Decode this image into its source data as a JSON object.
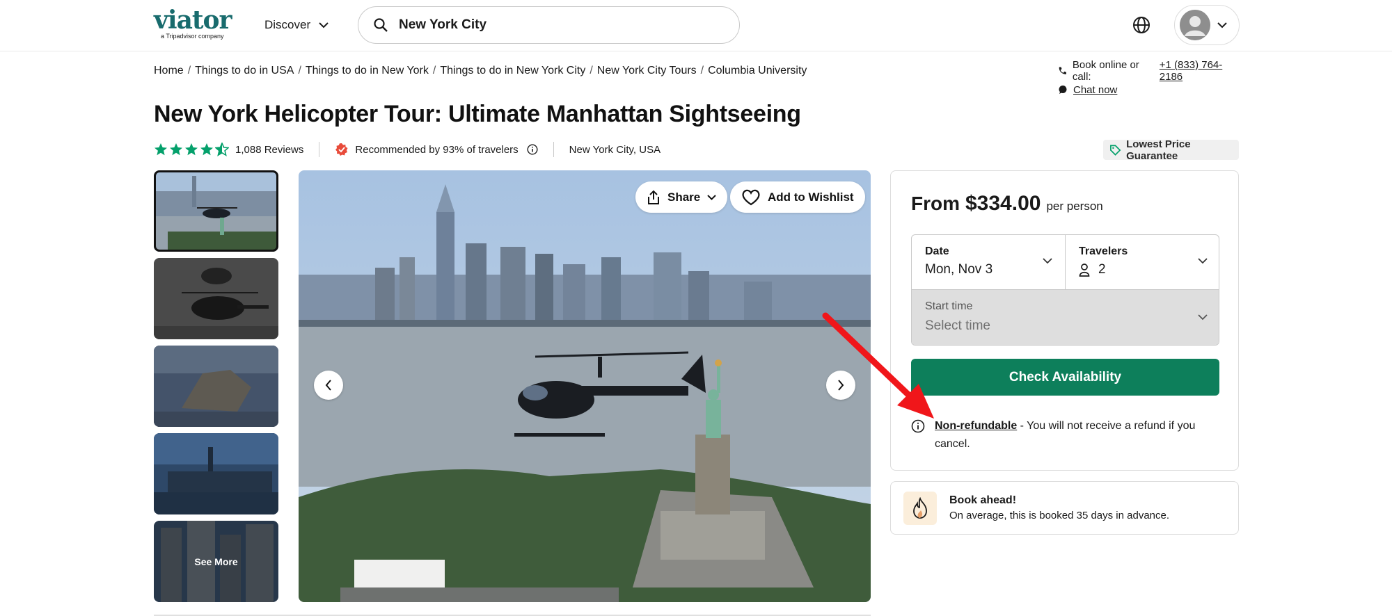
{
  "header": {
    "logo_text": "viator",
    "logo_sub": "a Tripadvisor company",
    "discover_label": "Discover",
    "search_value": "New York City",
    "brand_color": "#186b6d"
  },
  "breadcrumb": [
    "Home",
    "Things to do in USA",
    "Things to do in New York",
    "Things to do in New York City",
    "New York City Tours",
    "Columbia University"
  ],
  "contact": {
    "book_label": "Book online or call:",
    "phone": "+1 (833) 764-2186",
    "chat_label": "Chat now"
  },
  "product": {
    "title": "New York Helicopter Tour: Ultimate Manhattan Sightseeing",
    "rating": 4.5,
    "reviews_label": "1,088 Reviews",
    "recommended_label": "Recommended by 93% of travelers",
    "location": "New York City, USA",
    "lowest_price_label": "Lowest Price Guarantee",
    "star_color": "#04a06b"
  },
  "gallery": {
    "see_more_label": "See More",
    "share_label": "Share",
    "wishlist_label": "Add to Wishlist"
  },
  "booking": {
    "from_label": "From",
    "price": "$334.00",
    "per_person": "per person",
    "date_label": "Date",
    "date_value": "Mon, Nov 3",
    "travelers_label": "Travelers",
    "travelers_value": "2",
    "start_time_label": "Start time",
    "start_time_placeholder": "Select time",
    "check_button": "Check Availability",
    "button_color": "#0d7f5b",
    "nonrefundable_label": "Non-refundable",
    "nonrefundable_text": " - You will not receive a refund if you cancel."
  },
  "book_ahead": {
    "title": "Book ahead!",
    "subtitle": "On average, this is booked 35 days in advance."
  },
  "annotation_color": "#f0161a"
}
